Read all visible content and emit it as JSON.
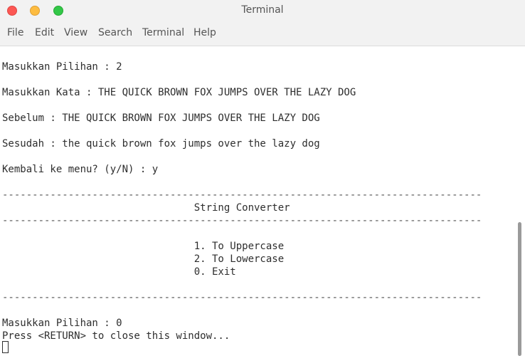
{
  "window": {
    "title": "Terminal"
  },
  "menubar": {
    "items": [
      "File",
      "Edit",
      "View",
      "Search",
      "Terminal",
      "Help"
    ]
  },
  "terminal": {
    "lines": [
      "Masukkan Pilihan : 2",
      "Masukkan Kata : THE QUICK BROWN FOX JUMPS OVER THE LAZY DOG",
      "Sebelum : THE QUICK BROWN FOX JUMPS OVER THE LAZY DOG",
      "Sesudah : the quick brown fox jumps over the lazy dog",
      "Kembali ke menu? (y/N) : y",
      "--------------------------------------------------------------------------------",
      "                                String Converter",
      "--------------------------------------------------------------------------------",
      "                                1. To Uppercase",
      "                                2. To Lowercase",
      "                                0. Exit",
      "--------------------------------------------------------------------------------",
      "Masukkan Pilihan : 0",
      "Press <RETURN> to close this window..."
    ]
  },
  "colors": {
    "close": "#fc5753",
    "minimize": "#fdbc40",
    "maximize": "#33c748",
    "chrome": "#f2f2f2",
    "text": "#2e2e2e"
  }
}
